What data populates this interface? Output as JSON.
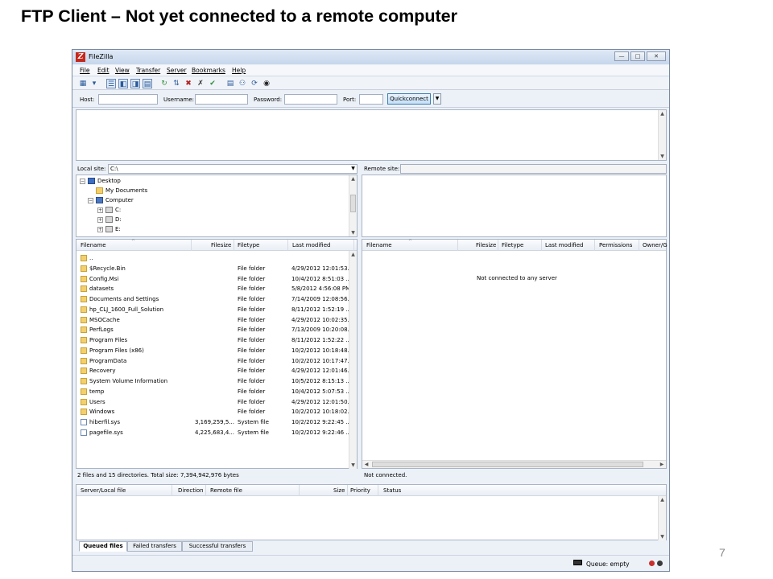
{
  "slide": {
    "title": "FTP Client – Not yet connected to a remote computer",
    "page_number": "7"
  },
  "window": {
    "app_icon": "filezilla-logo",
    "app_title": "FileZilla",
    "controls": [
      "minimize-icon",
      "maximize-icon",
      "close-icon"
    ]
  },
  "menu": {
    "items": [
      "File",
      "Edit",
      "View",
      "Transfer",
      "Server",
      "Bookmarks",
      "Help"
    ]
  },
  "toolbar": {
    "icons": [
      "site-manager-icon",
      "dropdown-arrow-icon",
      "toggle-message-log-icon",
      "toggle-local-tree-icon",
      "toggle-remote-tree-icon",
      "toggle-queue-icon",
      "refresh-icon",
      "process-queue-icon",
      "cancel-icon",
      "disconnect-icon",
      "reconnect-icon",
      "directory-comparison-icon",
      "filter-icon",
      "sync-browsing-icon",
      "search-icon"
    ]
  },
  "quickconnect": {
    "host_label": "Host:",
    "username_label": "Username:",
    "password_label": "Password:",
    "port_label": "Port:",
    "host_value": "",
    "username_value": "",
    "password_value": "",
    "port_value": "",
    "button_label": "Quickconnect"
  },
  "local": {
    "site_label": "Local site:",
    "site_value": "C:\\",
    "tree": [
      {
        "label": "Desktop",
        "icon": "desktop-icon",
        "expander": "−"
      },
      {
        "label": "My Documents",
        "icon": "folder-icon",
        "expander": ""
      },
      {
        "label": "Computer",
        "icon": "computer-icon",
        "expander": "−"
      },
      {
        "label": "C:",
        "icon": "drive-icon",
        "expander": "+"
      },
      {
        "label": "D:",
        "icon": "drive-icon",
        "expander": "+"
      },
      {
        "label": "E:",
        "icon": "drive-icon",
        "expander": "+"
      }
    ],
    "columns": [
      "Filename",
      "Filesize",
      "Filetype",
      "Last modified"
    ],
    "files": [
      {
        "name": "..",
        "size": "",
        "type": "",
        "modified": "",
        "icon": "folder-icon"
      },
      {
        "name": "$Recycle.Bin",
        "size": "",
        "type": "File folder",
        "modified": "4/29/2012 12:01:53...",
        "icon": "folder-icon"
      },
      {
        "name": "Config.Msi",
        "size": "",
        "type": "File folder",
        "modified": "10/4/2012 8:51:03 ...",
        "icon": "folder-icon"
      },
      {
        "name": "datasets",
        "size": "",
        "type": "File folder",
        "modified": "5/8/2012 4:56:08 PM",
        "icon": "folder-icon"
      },
      {
        "name": "Documents and Settings",
        "size": "",
        "type": "File folder",
        "modified": "7/14/2009 12:08:56...",
        "icon": "folder-icon"
      },
      {
        "name": "hp_CLJ_1600_Full_Solution",
        "size": "",
        "type": "File folder",
        "modified": "8/11/2012 1:52:19 ...",
        "icon": "folder-icon"
      },
      {
        "name": "MSOCache",
        "size": "",
        "type": "File folder",
        "modified": "4/29/2012 10:02:35...",
        "icon": "folder-icon"
      },
      {
        "name": "PerfLogs",
        "size": "",
        "type": "File folder",
        "modified": "7/13/2009 10:20:08...",
        "icon": "folder-icon"
      },
      {
        "name": "Program Files",
        "size": "",
        "type": "File folder",
        "modified": "8/11/2012 1:52:22 ...",
        "icon": "folder-icon"
      },
      {
        "name": "Program Files (x86)",
        "size": "",
        "type": "File folder",
        "modified": "10/2/2012 10:18:48...",
        "icon": "folder-icon"
      },
      {
        "name": "ProgramData",
        "size": "",
        "type": "File folder",
        "modified": "10/2/2012 10:17:47...",
        "icon": "folder-icon"
      },
      {
        "name": "Recovery",
        "size": "",
        "type": "File folder",
        "modified": "4/29/2012 12:01:46...",
        "icon": "folder-icon"
      },
      {
        "name": "System Volume Information",
        "size": "",
        "type": "File folder",
        "modified": "10/5/2012 8:15:13 ...",
        "icon": "folder-icon"
      },
      {
        "name": "temp",
        "size": "",
        "type": "File folder",
        "modified": "10/4/2012 5:07:53 ...",
        "icon": "folder-icon"
      },
      {
        "name": "Users",
        "size": "",
        "type": "File folder",
        "modified": "4/29/2012 12:01:50...",
        "icon": "folder-icon"
      },
      {
        "name": "Windows",
        "size": "",
        "type": "File folder",
        "modified": "10/2/2012 10:18:02...",
        "icon": "folder-icon"
      },
      {
        "name": "hiberfil.sys",
        "size": "3,169,259,5...",
        "type": "System file",
        "modified": "10/2/2012 9:22:45 ...",
        "icon": "system-file-icon"
      },
      {
        "name": "pagefile.sys",
        "size": "4,225,683,4...",
        "type": "System file",
        "modified": "10/2/2012 9:22:46 ...",
        "icon": "system-file-icon"
      }
    ],
    "status": "2 files and 15 directories. Total size: 7,394,942,976 bytes"
  },
  "remote": {
    "site_label": "Remote site:",
    "site_value": "",
    "columns": [
      "Filename",
      "Filesize",
      "Filetype",
      "Last modified",
      "Permissions",
      "Owner/G"
    ],
    "empty_message": "Not connected to any server",
    "status": "Not connected."
  },
  "queue": {
    "columns": [
      "Server/Local file",
      "Direction",
      "Remote file",
      "Size",
      "Priority",
      "Status"
    ],
    "tabs": [
      "Queued files",
      "Failed transfers",
      "Successful transfers"
    ],
    "status": "Queue: empty"
  },
  "colors": {
    "window_bg": "#ecf1f8",
    "folder": "#f3d06b",
    "quickconnect_border": "#3c7fb1",
    "light_red": "#c9302c",
    "light_green": "#3a3a3a"
  }
}
